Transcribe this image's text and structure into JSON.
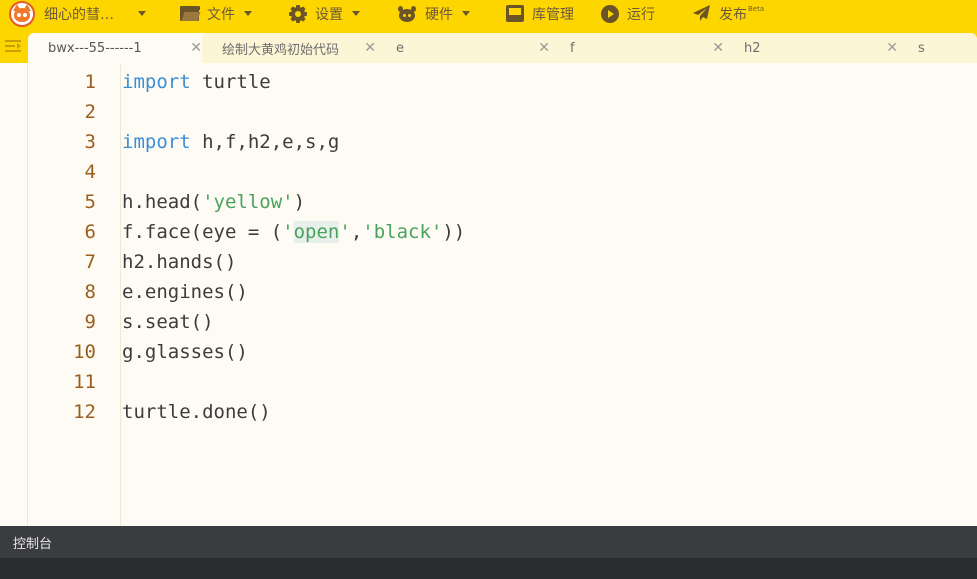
{
  "menubar": {
    "project_name": "细心的彗…",
    "items": [
      {
        "label": "文件",
        "icon": "folder-icon"
      },
      {
        "label": "设置",
        "icon": "gear-icon"
      },
      {
        "label": "硬件",
        "icon": "robot-icon"
      },
      {
        "label": "库管理",
        "icon": "tray-icon"
      },
      {
        "label": "运行",
        "icon": "play-icon"
      },
      {
        "label": "发布",
        "icon": "paper-plane-icon",
        "badge": "Beta"
      }
    ]
  },
  "tabs": [
    {
      "label": "bwx---55------1",
      "active": true
    },
    {
      "label": "绘制大黄鸡初始代码",
      "active": false
    },
    {
      "label": "e",
      "active": false
    },
    {
      "label": "f",
      "active": false
    },
    {
      "label": "h2",
      "active": false
    },
    {
      "label": "s",
      "active": false
    }
  ],
  "editor": {
    "line_numbers": [
      "1",
      "2",
      "3",
      "4",
      "5",
      "6",
      "7",
      "8",
      "9",
      "10",
      "11",
      "12"
    ],
    "lines": [
      "import turtle",
      "",
      "import h,f,h2,e,s,g",
      "",
      "h.head('yellow')",
      "f.face(eye = ('open','black'))",
      "h2.hands()",
      "e.engines()",
      "s.seat()",
      "g.glasses()",
      "",
      "turtle.done()"
    ]
  },
  "console": {
    "title": "控制台"
  },
  "colors": {
    "menubar": "#fdd600",
    "keyword": "#3b8fd6",
    "string": "#4aa35d",
    "line_number": "#9a5f1e",
    "console": "#3b3c3f"
  }
}
